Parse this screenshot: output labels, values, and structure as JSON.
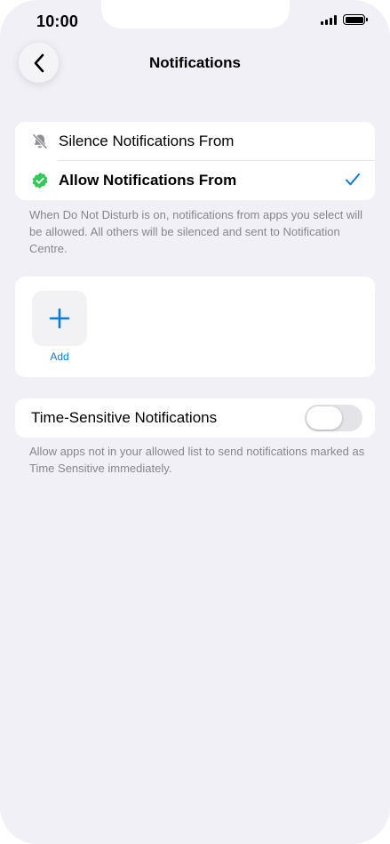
{
  "status_bar": {
    "time": "10:00"
  },
  "nav": {
    "title": "Notifications"
  },
  "mode_options": [
    {
      "label": "Silence Notifications From",
      "icon": "bell-slash-icon",
      "selected": false
    },
    {
      "label": "Allow Notifications From",
      "icon": "checkmark-badge-icon",
      "selected": true
    }
  ],
  "mode_footnote": "When Do Not Disturb is on, notifications from apps you select will be allowed. All others will be silenced and sent to Notification Centre.",
  "add_section": {
    "add_label": "Add"
  },
  "time_sensitive": {
    "label": "Time-Sensitive Notifications",
    "enabled": false,
    "footnote": "Allow apps not in your allowed list to send notifications marked as Time Sensitive immediately."
  },
  "colors": {
    "accent": "#0a7bd9",
    "allow_badge": "#35c759",
    "background": "#f1f0f6"
  }
}
